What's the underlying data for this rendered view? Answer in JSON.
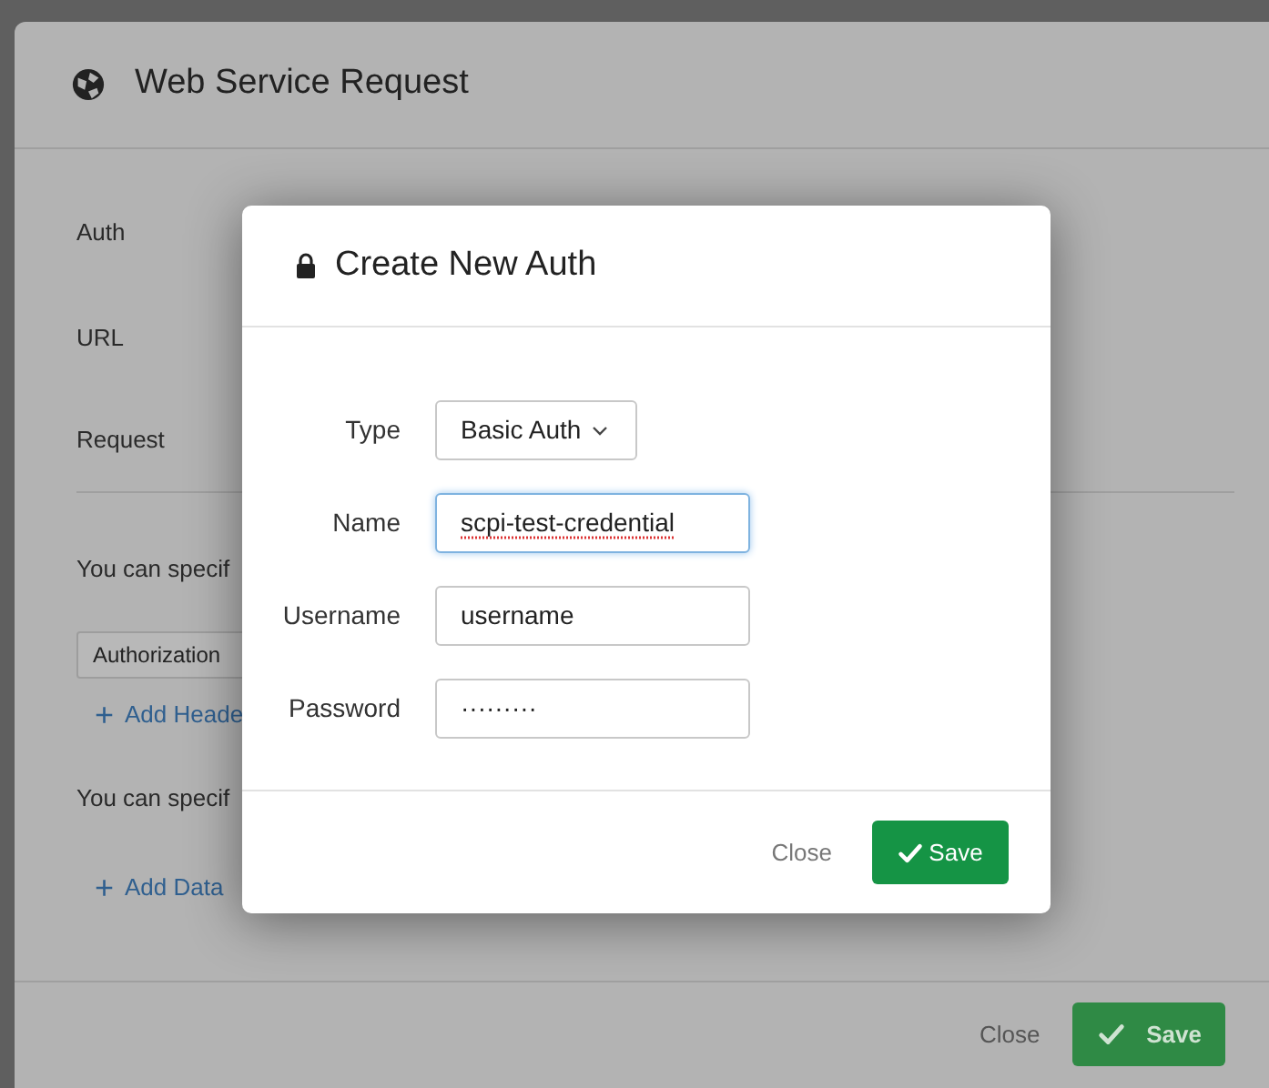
{
  "window": {
    "title": "Web Service Request"
  },
  "form_rows": [
    {
      "label": "Auth"
    },
    {
      "label": "URL"
    },
    {
      "label": "Request"
    }
  ],
  "headers_hint": "You can specif",
  "header_field": {
    "value": "Authorization"
  },
  "add_header_link": {
    "icon": "+",
    "label": "Add Heade"
  },
  "data_hint": "You can specif",
  "add_data_link": {
    "icon": "+",
    "label": "Add Data"
  },
  "footer": {
    "close": "Close",
    "save": "Save"
  },
  "dialog": {
    "title": "Create New Auth",
    "fields": [
      {
        "kind": "select",
        "label": "Type",
        "value": "Basic Auth"
      },
      {
        "kind": "text",
        "label": "Name",
        "value": "scpi-test-credential",
        "focused": true,
        "misspelled": true
      },
      {
        "kind": "text",
        "label": "Username",
        "value": "username",
        "focused": false,
        "misspelled": false
      },
      {
        "kind": "text",
        "label": "Password",
        "value": "·········",
        "focused": false,
        "misspelled": false
      }
    ],
    "close": "Close",
    "save": "Save"
  }
}
